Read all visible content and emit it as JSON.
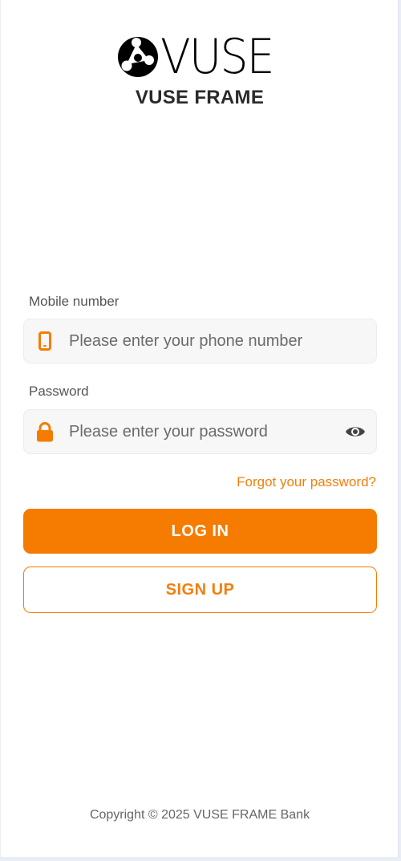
{
  "brand": {
    "logo_text": "VUSE",
    "app_title": "VUSE FRAME",
    "accent_color": "#f57c00"
  },
  "form": {
    "mobile": {
      "label": "Mobile number",
      "placeholder": "Please enter your phone number",
      "value": "",
      "icon": "phone-icon"
    },
    "password": {
      "label": "Password",
      "placeholder": "Please enter your password",
      "value": "",
      "icon": "lock-icon",
      "toggle_icon": "eye-icon"
    },
    "forgot_link": "Forgot your password?",
    "login_label": "LOG IN",
    "signup_label": "SIGN UP"
  },
  "footer": {
    "copyright": "Copyright © 2025 VUSE FRAME Bank"
  }
}
